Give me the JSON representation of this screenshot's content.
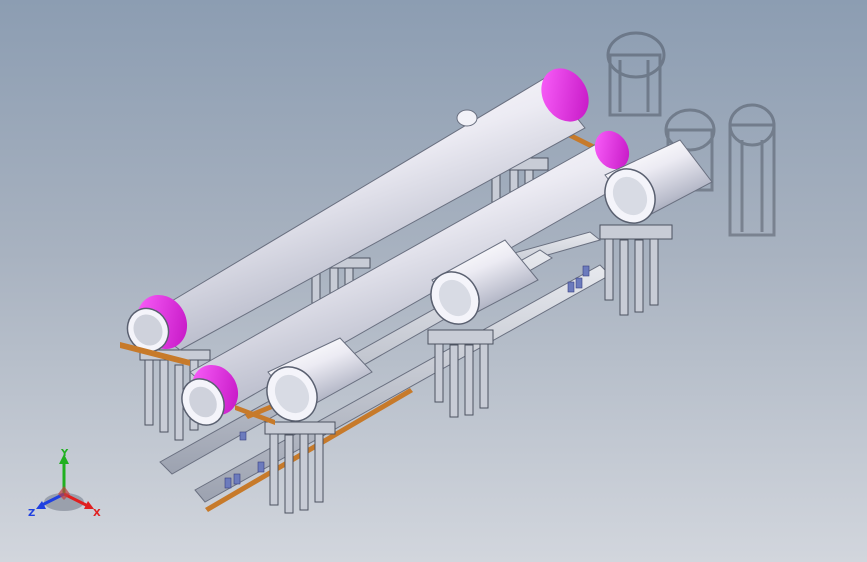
{
  "viewport": {
    "background_top": "#8c9db2",
    "background_bottom": "#d2d6dd"
  },
  "colors": {
    "pipe_face": "#e6e6ef",
    "pipe_shadow": "#9aa0b3",
    "pipe_end_cap": "#e020e0",
    "frame_steel": "#c8ccd6",
    "frame_dark": "#5a6070",
    "rail_copper": "#c77a2a"
  },
  "triad": {
    "x_label": "X",
    "y_label": "Y",
    "z_label": "Z",
    "x_color": "#e02020",
    "y_color": "#20b020",
    "z_color": "#2040e0"
  }
}
